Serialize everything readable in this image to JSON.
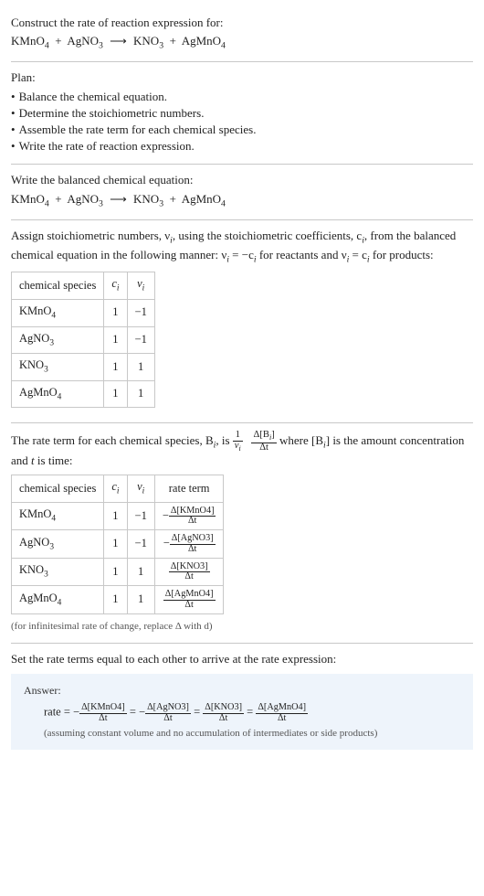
{
  "intro": {
    "line1": "Construct the rate of reaction expression for:",
    "eq_lhs1": "KMnO",
    "eq_lhs1s": "4",
    "eq_lhs2": "AgNO",
    "eq_lhs2s": "3",
    "eq_rhs1": "KNO",
    "eq_rhs1s": "3",
    "eq_rhs2": "AgMnO",
    "eq_rhs2s": "4"
  },
  "plan": {
    "title": "Plan:",
    "items": [
      "Balance the chemical equation.",
      "Determine the stoichiometric numbers.",
      "Assemble the rate term for each chemical species.",
      "Write the rate of reaction expression."
    ]
  },
  "balanced": {
    "title": "Write the balanced chemical equation:"
  },
  "stoich": {
    "para_a": "Assign stoichiometric numbers, ν",
    "para_b": ", using the stoichiometric coefficients, c",
    "para_c": ", from the balanced chemical equation in the following manner: ν",
    "para_d": " = −c",
    "para_e": " for reactants and ν",
    "para_f": " = c",
    "para_g": " for products:",
    "i": "i",
    "table": {
      "h1": "chemical species",
      "h2": "c",
      "h3": "ν",
      "rows": [
        {
          "sp": "KMnO",
          "sps": "4",
          "c": "1",
          "v": "−1"
        },
        {
          "sp": "AgNO",
          "sps": "3",
          "c": "1",
          "v": "−1"
        },
        {
          "sp": "KNO",
          "sps": "3",
          "c": "1",
          "v": "1"
        },
        {
          "sp": "AgMnO",
          "sps": "4",
          "c": "1",
          "v": "1"
        }
      ]
    }
  },
  "rateterm": {
    "para_a": "The rate term for each chemical species, B",
    "para_b": ", is ",
    "para_c": " where [B",
    "para_d": "] is the amount concentration and ",
    "para_e": " is time:",
    "i": "i",
    "t": "t",
    "f1n": "1",
    "f1d_a": "ν",
    "f1d_b": "i",
    "f2n_a": "Δ[B",
    "f2n_b": "i",
    "f2n_c": "]",
    "f2d": "Δt",
    "table": {
      "h1": "chemical species",
      "h2": "c",
      "h3": "ν",
      "h4": "rate term",
      "rows": [
        {
          "sp": "KMnO",
          "sps": "4",
          "c": "1",
          "v": "−1",
          "neg": "−",
          "num": "Δ[KMnO4]",
          "den": "Δt"
        },
        {
          "sp": "AgNO",
          "sps": "3",
          "c": "1",
          "v": "−1",
          "neg": "−",
          "num": "Δ[AgNO3]",
          "den": "Δt"
        },
        {
          "sp": "KNO",
          "sps": "3",
          "c": "1",
          "v": "1",
          "neg": "",
          "num": "Δ[KNO3]",
          "den": "Δt"
        },
        {
          "sp": "AgMnO",
          "sps": "4",
          "c": "1",
          "v": "1",
          "neg": "",
          "num": "Δ[AgMnO4]",
          "den": "Δt"
        }
      ]
    },
    "note": "(for infinitesimal rate of change, replace Δ with d)"
  },
  "setequal": {
    "para": "Set the rate terms equal to each other to arrive at the rate expression:"
  },
  "answer": {
    "label": "Answer:",
    "rate": "rate = ",
    "terms": [
      {
        "neg": "−",
        "num": "Δ[KMnO4]",
        "den": "Δt"
      },
      {
        "neg": "−",
        "num": "Δ[AgNO3]",
        "den": "Δt"
      },
      {
        "neg": "",
        "num": "Δ[KNO3]",
        "den": "Δt"
      },
      {
        "neg": "",
        "num": "Δ[AgMnO4]",
        "den": "Δt"
      }
    ],
    "eq": " = ",
    "note": "(assuming constant volume and no accumulation of intermediates or side products)"
  },
  "chart_data": {
    "type": "table",
    "tables": [
      {
        "title": "Stoichiometric numbers",
        "columns": [
          "chemical species",
          "c_i",
          "ν_i"
        ],
        "rows": [
          [
            "KMnO4",
            1,
            -1
          ],
          [
            "AgNO3",
            1,
            -1
          ],
          [
            "KNO3",
            1,
            1
          ],
          [
            "AgMnO4",
            1,
            1
          ]
        ]
      },
      {
        "title": "Rate terms",
        "columns": [
          "chemical species",
          "c_i",
          "ν_i",
          "rate term"
        ],
        "rows": [
          [
            "KMnO4",
            1,
            -1,
            "-Δ[KMnO4]/Δt"
          ],
          [
            "AgNO3",
            1,
            -1,
            "-Δ[AgNO3]/Δt"
          ],
          [
            "KNO3",
            1,
            1,
            "Δ[KNO3]/Δt"
          ],
          [
            "AgMnO4",
            1,
            1,
            "Δ[AgMnO4]/Δt"
          ]
        ]
      }
    ],
    "rate_expression": "rate = -Δ[KMnO4]/Δt = -Δ[AgNO3]/Δt = Δ[KNO3]/Δt = Δ[AgMnO4]/Δt"
  }
}
